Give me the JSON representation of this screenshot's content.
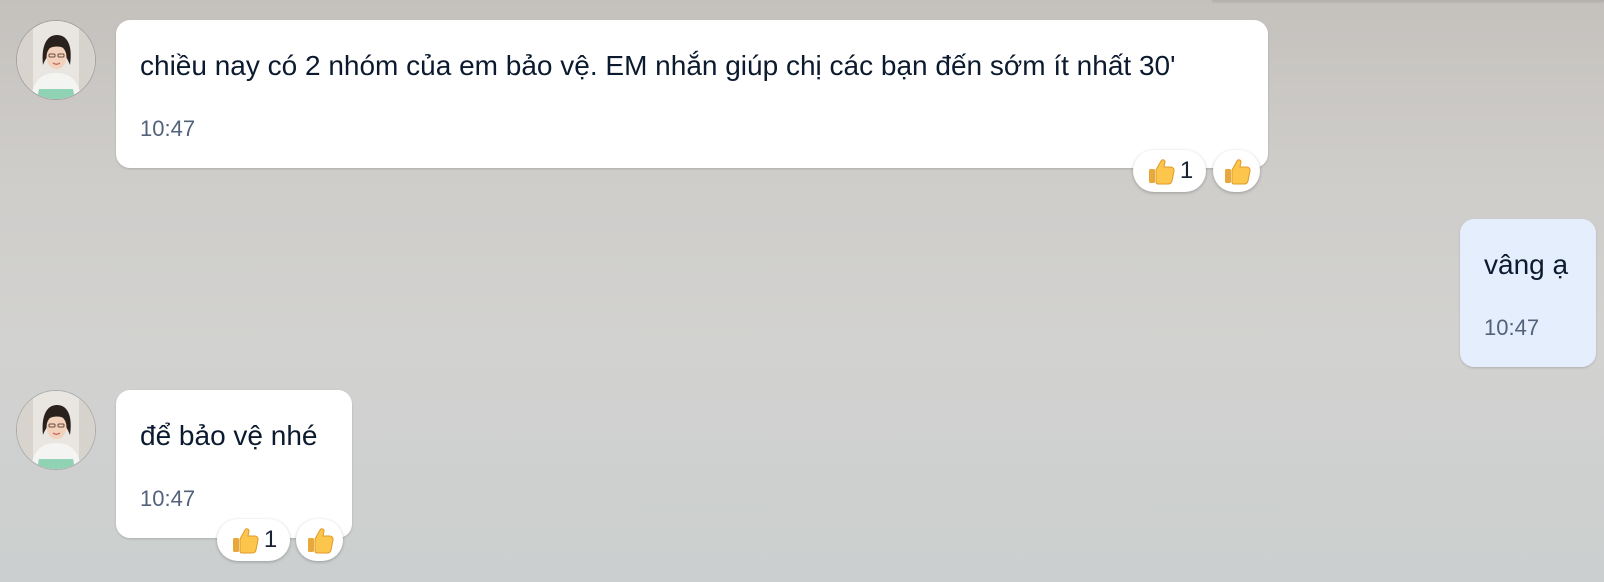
{
  "messages": [
    {
      "sender": "other",
      "text": "chiều nay có 2 nhóm của em bảo vệ. EM nhắn giúp chị các bạn đến sớm ít nhất 30'",
      "time": "10:47",
      "reaction_count": "1"
    },
    {
      "sender": "me",
      "text": "vâng ạ",
      "time": "10:47"
    },
    {
      "sender": "other",
      "text": "để bảo vệ nhé",
      "time": "10:47",
      "reaction_count": "1"
    }
  ],
  "icons": {
    "reaction": "thumbs-up-icon",
    "avatar": "user-photo-avatar"
  },
  "colors": {
    "bubble_other": "#ffffff",
    "bubble_mine": "#e5eefc",
    "time_text": "#52627a",
    "message_text": "#0b1a2e"
  }
}
